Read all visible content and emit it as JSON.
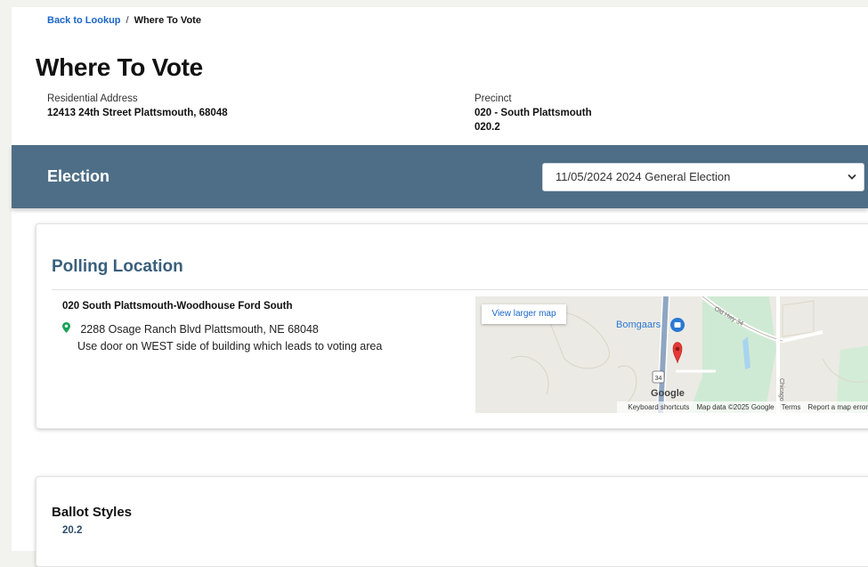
{
  "breadcrumb": {
    "back_link": "Back to Lookup",
    "separator": "/",
    "current": "Where To Vote"
  },
  "page": {
    "title": "Where To Vote"
  },
  "residential": {
    "label": "Residential Address",
    "value": "12413 24th Street Plattsmouth, 68048"
  },
  "precinct": {
    "label": "Precinct",
    "name": "020 - South Plattsmouth",
    "code": "020.2"
  },
  "election": {
    "title": "Election",
    "selected": "11/05/2024 2024 General Election",
    "dropdown_icon": "chevron-down-icon",
    "bar_color": "#4e6e87"
  },
  "polling": {
    "title": "Polling Location",
    "location_name": "020 South Plattsmouth-Woodhouse Ford South",
    "pin_icon": "map-pin-icon",
    "address": "2288 Osage Ranch Blvd Plattsmouth, NE 68048",
    "note": "Use door on WEST side of building which leads to voting area"
  },
  "map": {
    "view_larger": "View larger map",
    "place_label": "Bomgaars",
    "road_label": "Old Hwy 34",
    "road_label_2": "Chicago",
    "shield_label": "34",
    "google_logo": "Google",
    "keyboard_shortcuts": "Keyboard shortcuts",
    "map_data": "Map data ©2025 Google",
    "terms": "Terms",
    "report": "Report a map error"
  },
  "ballot": {
    "title": "Ballot Styles",
    "items": [
      "20.2"
    ]
  },
  "colors": {
    "link": "#1a66c9",
    "heading": "#3a5f7c",
    "pin": "#1aa35a"
  }
}
